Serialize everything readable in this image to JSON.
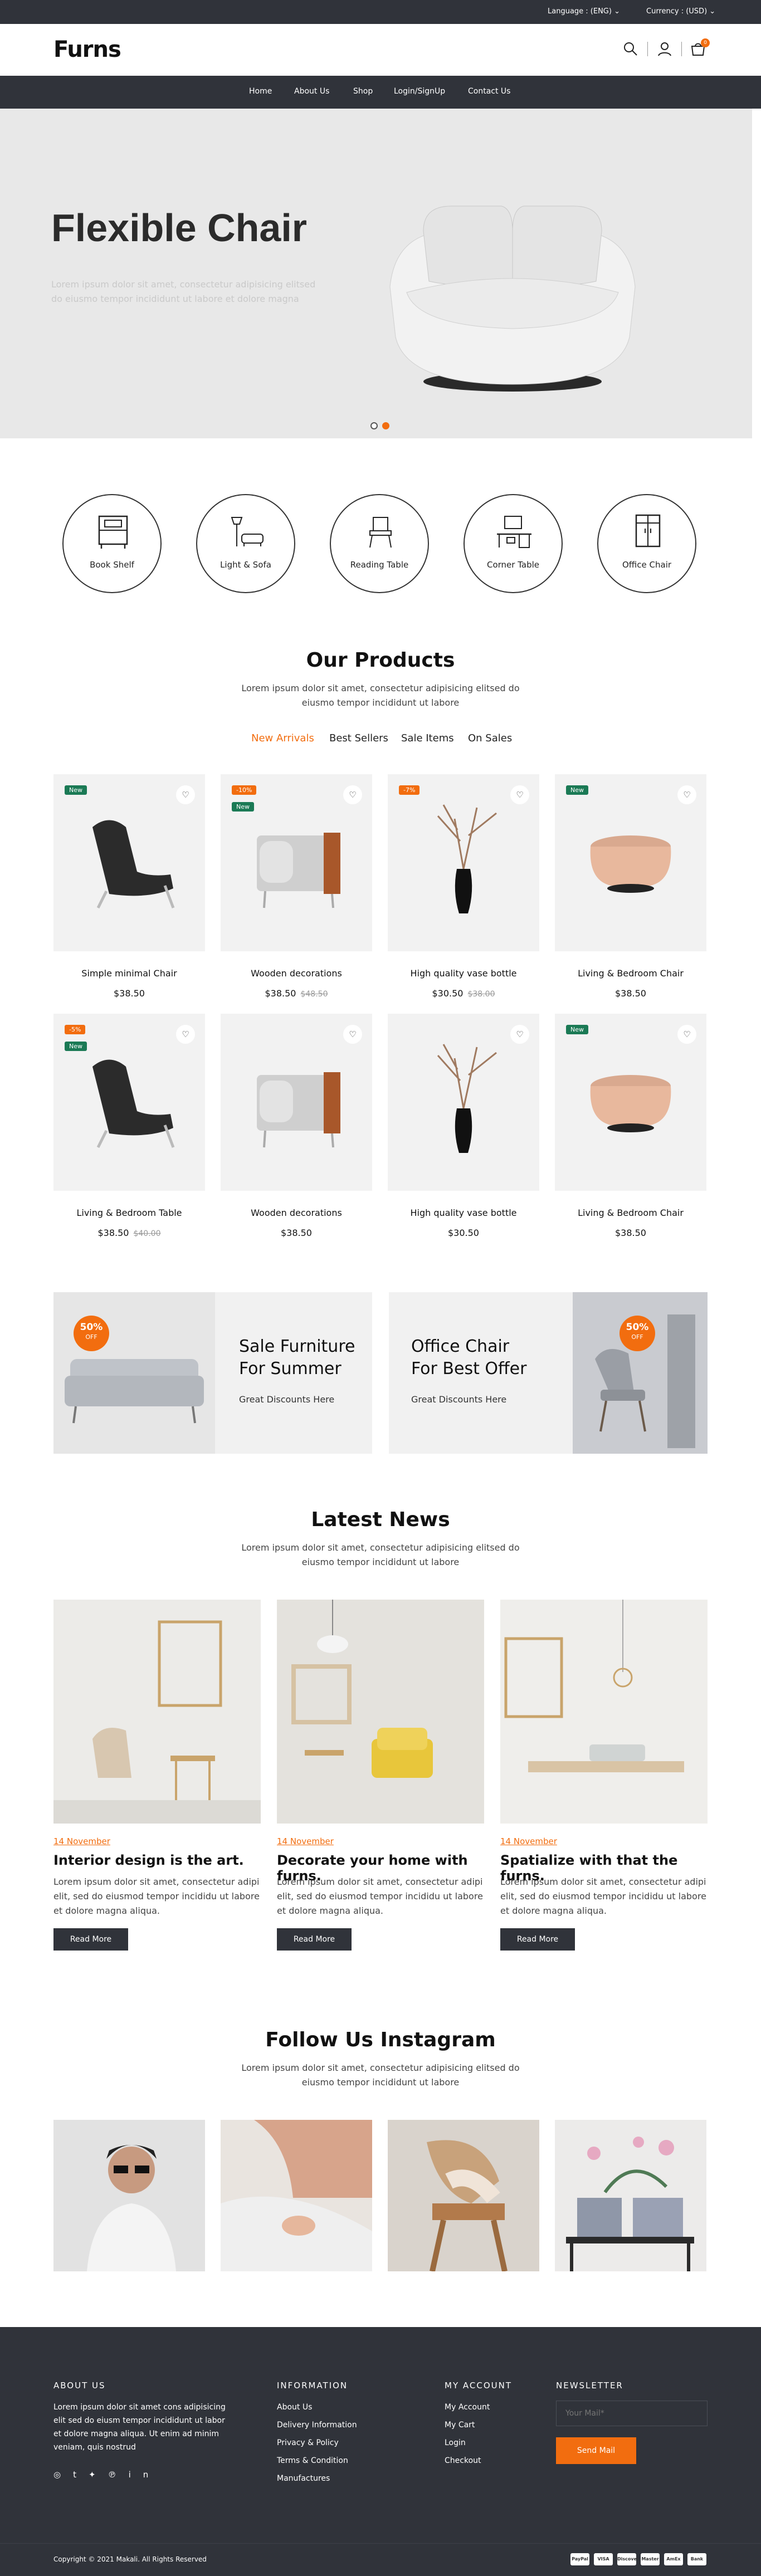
{
  "topbar": {
    "language": "Language : (ENG)",
    "currency": "Currency : (USD)"
  },
  "header": {
    "logo": "Furns",
    "cart_count": "0"
  },
  "nav": [
    "Home",
    "About Us",
    "Shop",
    "Login/SignUp",
    "Contact Us"
  ],
  "hero": {
    "title": "Flexible Chair",
    "subtitle": "Lorem ipsum dolor sit amet, consectetur adipisicing elitsed do eiusmo tempor incididunt ut labore et dolore magna"
  },
  "categories": [
    "Book Shelf",
    "Light & Sofa",
    "Reading Table",
    "Corner Table",
    "Office Chair"
  ],
  "products": {
    "title": "Our Products",
    "subtitle_line1": "Lorem ipsum dolor sit amet, consectetur adipisicing elitsed do",
    "subtitle_line2": "eiusmo tempor incididunt ut labore",
    "tabs": [
      "New Arrivals",
      "Best Sellers",
      "Sale Items",
      "On Sales"
    ],
    "items": [
      {
        "name": "Simple minimal Chair",
        "price": "$38.50",
        "old": "",
        "badges": [
          "New"
        ]
      },
      {
        "name": "Wooden decorations",
        "price": "$38.50",
        "old": "$48.50",
        "badges": [
          "-10%",
          "New"
        ]
      },
      {
        "name": "High quality vase bottle",
        "price": "$30.50",
        "old": "$38.00",
        "badges": [
          "-7%"
        ]
      },
      {
        "name": "Living & Bedroom Chair",
        "price": "$38.50",
        "old": "",
        "badges": [
          "New"
        ]
      },
      {
        "name": "Living & Bedroom Table",
        "price": "$38.50",
        "old": "$40.00",
        "badges": [
          "-5%",
          "New"
        ]
      },
      {
        "name": "Wooden decorations",
        "price": "$38.50",
        "old": "",
        "badges": []
      },
      {
        "name": "High quality vase bottle",
        "price": "$30.50",
        "old": "",
        "badges": []
      },
      {
        "name": "Living & Bedroom Chair",
        "price": "$38.50",
        "old": "",
        "badges": [
          "New"
        ]
      }
    ]
  },
  "banners": [
    {
      "title_line1": "Sale Furniture",
      "title_line2": "For Summer",
      "sub": "Great Discounts Here",
      "offer": "50%",
      "offer_sub": "OFF"
    },
    {
      "title_line1": "Office Chair",
      "title_line2": "For Best Offer",
      "sub": "Great Discounts Here",
      "offer": "50%",
      "offer_sub": "OFF"
    }
  ],
  "news": {
    "title": "Latest News",
    "subtitle_line1": "Lorem ipsum dolor sit amet, consectetur adipisicing elitsed do",
    "subtitle_line2": "eiusmo tempor incididunt ut labore",
    "items": [
      {
        "date": "14 November",
        "title": "Interior design is the art.",
        "text": "Lorem ipsum dolor sit amet, consectetur adipi elit, sed do eiusmod tempor incididu ut labore et dolore magna aliqua.",
        "button": "Read More"
      },
      {
        "date": "14 November",
        "title": "Decorate your home with furns.",
        "text": "Lorem ipsum dolor sit amet, consectetur adipi elit, sed do eiusmod tempor incididu ut labore et dolore magna aliqua.",
        "button": "Read More"
      },
      {
        "date": "14 November",
        "title": "Spatialize with that the furns.",
        "text": "Lorem ipsum dolor sit amet, consectetur adipi elit, sed do eiusmod tempor incididu ut labore et dolore magna aliqua.",
        "button": "Read More"
      }
    ]
  },
  "instagram": {
    "title": "Follow Us Instagram",
    "subtitle_line1": "Lorem ipsum dolor sit amet, consectetur adipisicing elitsed do",
    "subtitle_line2": "eiusmo tempor incididunt ut labore"
  },
  "footer": {
    "about_title": "ABOUT US",
    "about_text": "Lorem ipsum dolor sit amet cons adipisicing elit sed do eiusm tempor incididunt ut labor et dolore magna aliqua. Ut enim ad minim veniam, quis nostrud",
    "info_title": "INFORMATION",
    "info_links": [
      "About Us",
      "Delivery Information",
      "Privacy & Policy",
      "Terms & Condition",
      "Manufactures"
    ],
    "account_title": "MY ACCOUNT",
    "account_links": [
      "My Account",
      "My Cart",
      "Login",
      "Checkout"
    ],
    "newsletter_title": "NEWSLETTER",
    "newsletter_placeholder": "Your Mail*",
    "newsletter_button": "Send Mail",
    "copyright": "Copyright © 2021 Makali. All Rights Reserved",
    "payments": [
      "PayPal",
      "VISA",
      "Discover",
      "Master",
      "AmEx",
      "Bank"
    ]
  },
  "colors": {
    "accent": "#f26d0f",
    "dark": "#30333a",
    "new_badge": "#1b7a55"
  }
}
